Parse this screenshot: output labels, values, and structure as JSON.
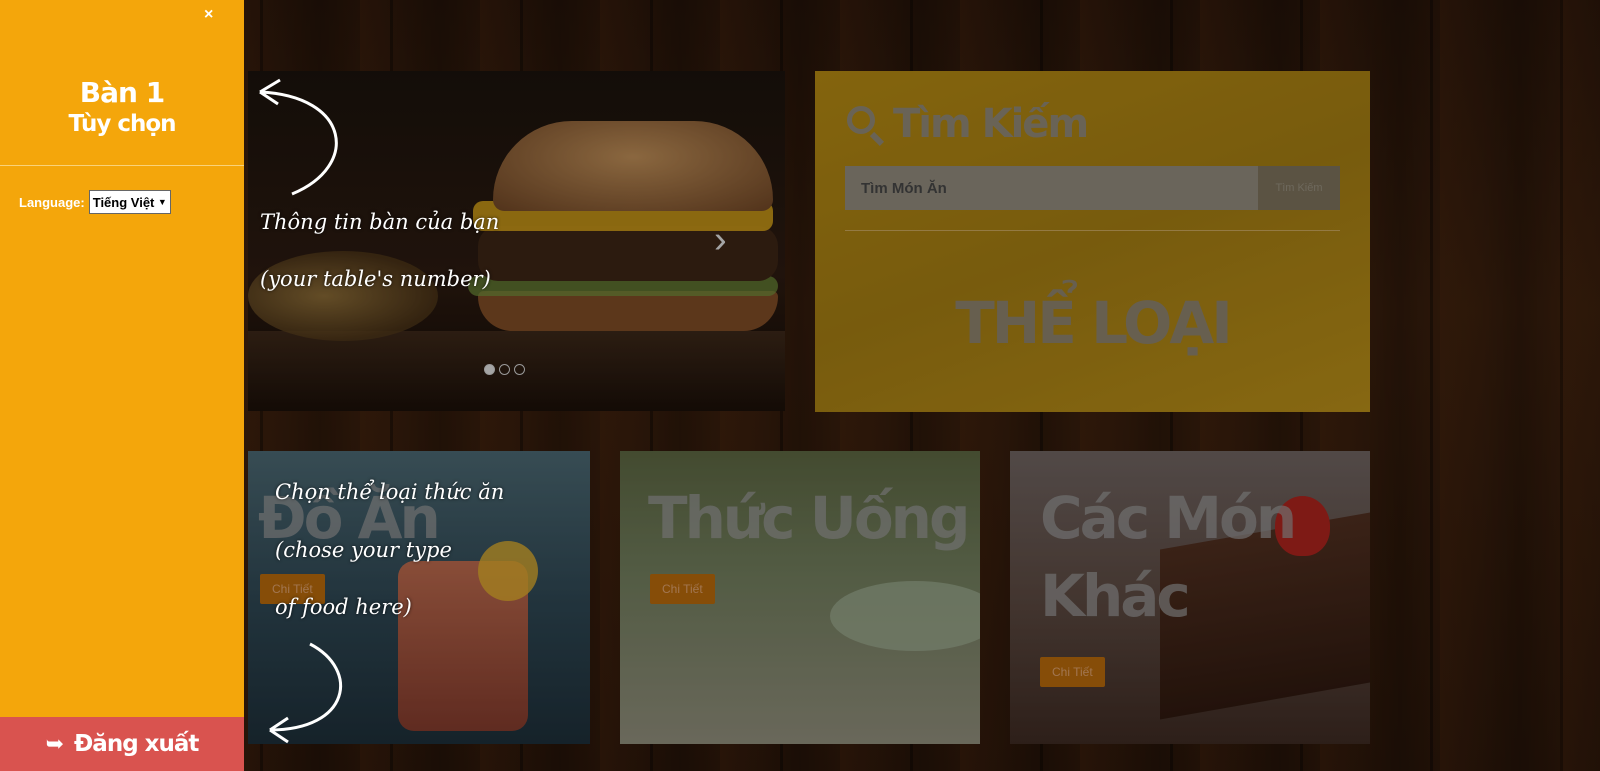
{
  "sidebar": {
    "close_icon": "×",
    "table_title": "Bàn 1",
    "options_title": "Tùy chọn",
    "language_label": "Language:",
    "language_value": "Tiếng Việt",
    "logout_label": "Đăng xuất",
    "logout_icon": "sign-out-icon"
  },
  "carousel": {
    "next_icon": "›",
    "slides_count": 3,
    "active_slide": 1
  },
  "search": {
    "title": "Tìm Kiếm",
    "placeholder": "Tìm Món Ăn",
    "button_label": "Tìm Kiếm",
    "category_heading": "THỂ LOẠI"
  },
  "categories": [
    {
      "title": "Đồ Ăn",
      "button_label": "Chi Tiết"
    },
    {
      "title": "Thức Uống",
      "button_label": "Chi Tiết"
    },
    {
      "title_line1": "Các Món",
      "title_line2": "Khác",
      "button_label": "Chi Tiết"
    }
  ],
  "tutorial": {
    "table_note_line1": "Thông tin bàn của bạn",
    "table_note_line2": "(your table's number)",
    "food_note_line1": "Chọn thể loại thức ăn",
    "food_note_line2": "(chose  your type",
    "food_note_line3": "of food here)"
  },
  "colors": {
    "sidebar": "#f4a60b",
    "logout": "#d9534f",
    "search_panel": "#b08612",
    "button": "#b3670b"
  }
}
